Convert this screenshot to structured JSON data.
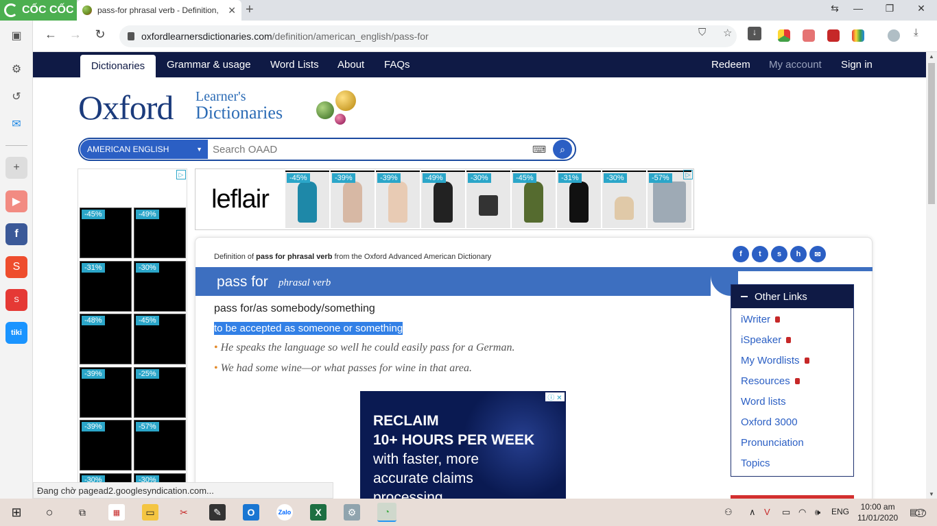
{
  "browser": {
    "brand": "CỐC CỐC",
    "tab_title": "pass-for phrasal verb - Definition, ",
    "url_host": "oxfordlearnersdictionaries.com",
    "url_path": "/definition/american_english/pass-for"
  },
  "nav": {
    "items": [
      "Dictionaries",
      "Grammar & usage",
      "Word Lists",
      "About",
      "FAQs"
    ],
    "right": [
      "Redeem",
      "My account",
      "Sign in"
    ]
  },
  "logo": {
    "main": "Oxford",
    "line1": "Learner's",
    "line2": "Dictionaries"
  },
  "search": {
    "dictionary": "AMERICAN ENGLISH",
    "placeholder": "Search OAAD"
  },
  "left_ad": {
    "discounts": [
      "-45%",
      "-49%",
      "-31%",
      "-30%",
      "-48%",
      "-45%",
      "-39%",
      "-25%",
      "-39%",
      "-57%",
      "-30%",
      "-30%"
    ]
  },
  "top_ad": {
    "brand": "leflair",
    "discounts": [
      "-45%",
      "-39%",
      "-39%",
      "-49%",
      "-30%",
      "-45%",
      "-31%",
      "-30%",
      "-57%"
    ]
  },
  "entry": {
    "definition_prefix": "Definition of ",
    "definition_word": "pass for phrasal verb",
    "definition_suffix": " from the Oxford Advanced American Dictionary",
    "headword": "pass for",
    "pos": "phrasal verb",
    "idiom": "pass for/as somebody/something",
    "definition": "to be accepted as someone or something",
    "examples": [
      "He speaks the language so well he could easily pass for a German.",
      "We had some wine—or what passes for wine in that area."
    ]
  },
  "inline_ad": {
    "lines": [
      "RECLAIM",
      "10+ HOURS PER WEEK",
      "with faster, more",
      "accurate claims",
      "processing"
    ]
  },
  "other_links": {
    "title": "Other Links",
    "items": [
      {
        "label": "iWriter",
        "locked": true
      },
      {
        "label": "iSpeaker",
        "locked": true
      },
      {
        "label": "My Wordlists",
        "locked": true
      },
      {
        "label": "Resources",
        "locked": true
      },
      {
        "label": "Word lists",
        "locked": false
      },
      {
        "label": "Oxford 3000",
        "locked": false
      },
      {
        "label": "Pronunciation",
        "locked": false
      },
      {
        "label": "Topics",
        "locked": false
      }
    ]
  },
  "status_text": "Đang chờ pagead2.googlesyndication.com...",
  "taskbar": {
    "lang": "ENG",
    "time": "10:00 am",
    "date": "11/01/2020",
    "notifications": "17"
  }
}
